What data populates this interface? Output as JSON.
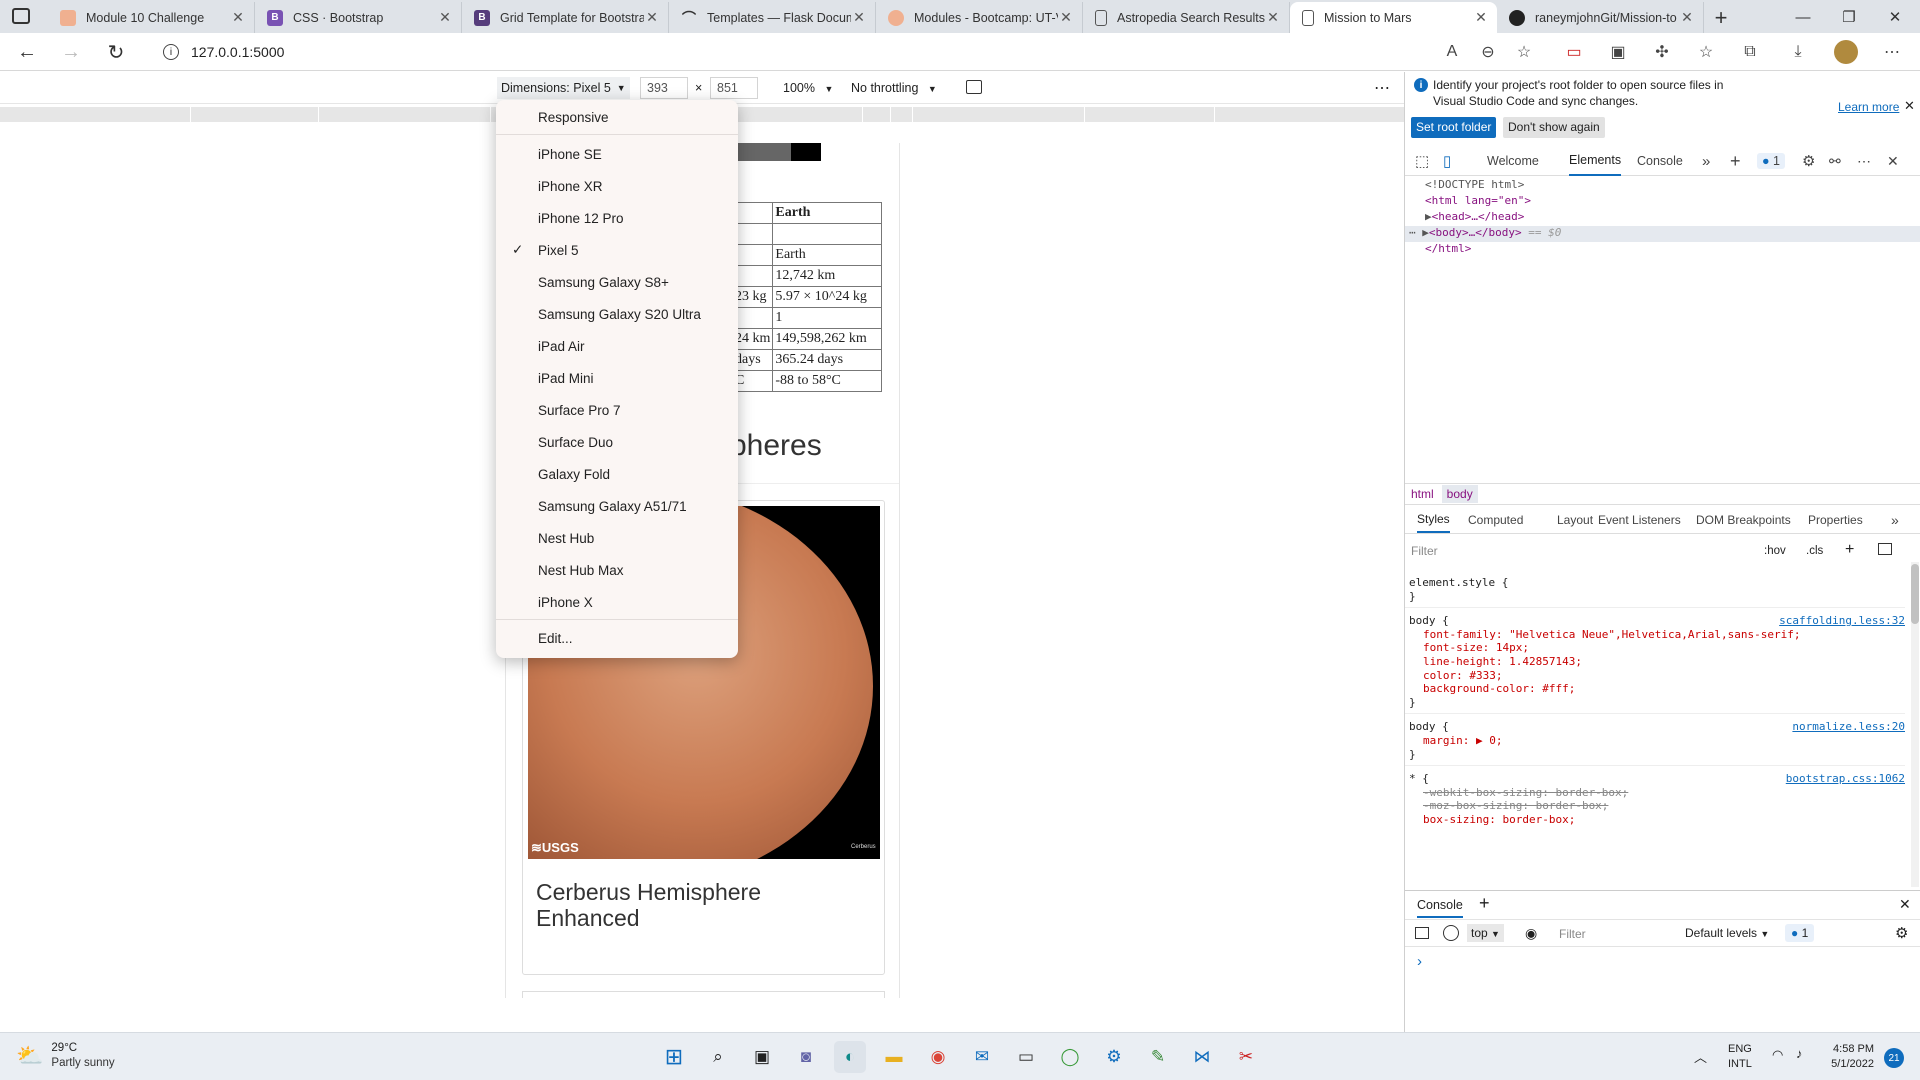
{
  "browser": {
    "tabs": [
      {
        "label": "Module 10 Challenge",
        "favicon": "orange-module-icon",
        "color": "#e8a07a"
      },
      {
        "label": "CSS · Bootstrap",
        "favicon": "bootstrap-icon",
        "color": "#7952b3"
      },
      {
        "label": "Grid Template for Bootstrap",
        "favicon": "bootstrap-icon",
        "color": "#563d7c"
      },
      {
        "label": "Templates — Flask Docum",
        "favicon": "flask-icon",
        "color": "#555555"
      },
      {
        "label": "Modules - Bootcamp: UT-V",
        "favicon": "canvas-icon",
        "color": "#e8a07a"
      },
      {
        "label": "Astropedia Search Results",
        "favicon": "page-icon",
        "color": "#888888"
      },
      {
        "label": "Mission to Mars",
        "favicon": "page-icon",
        "color": "#888888",
        "active": true
      },
      {
        "label": "raneymjohnGit/Mission-to",
        "favicon": "github-icon",
        "color": "#222222"
      }
    ],
    "new_tab": "+",
    "url": "127.0.0.1:5000"
  },
  "device_toolbar": {
    "dimensions_label": "Dimensions: Pixel 5",
    "width": "393",
    "times": "×",
    "height": "851",
    "zoom": "100%",
    "throttling": "No throttling",
    "more": "⋯"
  },
  "device_menu": {
    "responsive": "Responsive",
    "devices": [
      "iPhone SE",
      "iPhone XR",
      "iPhone 12 Pro",
      "Pixel 5",
      "Samsung Galaxy S8+",
      "Samsung Galaxy S20 Ultra",
      "iPad Air",
      "iPad Mini",
      "Surface Pro 7",
      "Surface Duo",
      "Galaxy Fold",
      "Samsung Galaxy A51/71",
      "Nest Hub",
      "Nest Hub Max",
      "iPhone X"
    ],
    "selected": "Pixel 5",
    "edit": "Edit..."
  },
  "page": {
    "table_header": "Earth",
    "table_rows": [
      [
        "",
        ""
      ],
      [
        "",
        "Earth"
      ],
      [
        "",
        "12,742 km"
      ],
      [
        "23 kg",
        "5.97 × 10^24 kg"
      ],
      [
        "",
        "1"
      ],
      [
        "24 km",
        "149,598,262 km"
      ],
      [
        "days",
        "365.24 days"
      ],
      [
        "C",
        "-88 to 58°C"
      ]
    ],
    "hemispheres_heading": "pheres",
    "card_title": "Cerberus Hemisphere Enhanced",
    "image_logo": "≋USGS",
    "image_caption": "Cerberus"
  },
  "devtools": {
    "notice": "Identify your project's root folder to open source files in Visual Studio Code and sync changes.",
    "learn_more": "Learn more",
    "set_root_folder": "Set root folder",
    "dont_show": "Don't show again",
    "tabs": [
      "Welcome",
      "Elements",
      "Console"
    ],
    "issue_count": "1",
    "dom": {
      "doctype": "<!DOCTYPE html>",
      "html_open": "<html lang=\"en\">",
      "head": "<head>…</head>",
      "body": "<body>…</body>",
      "body_suffix": "== $0",
      "html_close": "</html>"
    },
    "breadcrumbs": [
      "html",
      "body"
    ],
    "style_tabs": [
      "Styles",
      "Computed",
      "Layout",
      "Event Listeners",
      "DOM Breakpoints",
      "Properties"
    ],
    "filter_placeholder": "Filter",
    "hov": ":hov",
    "cls": ".cls",
    "rules": {
      "element_style": "element.style {",
      "close": "}",
      "body_selector": "body {",
      "source1": "scaffolding.less:32",
      "props1": [
        "font-family: \"Helvetica Neue\",Helvetica,Arial,sans-serif;",
        "font-size: 14px;",
        "line-height: 1.42857143;",
        "color: #333;",
        "background-color: #fff;"
      ],
      "source2": "normalize.less:20",
      "props2": [
        "margin: ▶ 0;"
      ],
      "universal": "* {",
      "source3": "bootstrap.css:1062",
      "props3": [
        "-webkit-box-sizing: border-box;",
        "-moz-box-sizing: border-box;",
        "box-sizing: border-box;"
      ]
    },
    "console": {
      "title": "Console",
      "context": "top",
      "filter_placeholder": "Filter",
      "levels": "Default levels",
      "count": "1",
      "prompt": "›"
    }
  },
  "taskbar": {
    "temperature": "29°C",
    "weather": "Partly sunny",
    "lang1": "ENG",
    "lang2": "INTL",
    "time": "4:58 PM",
    "date": "5/1/2022",
    "notifications": "21"
  },
  "colors": {
    "accent": "#0f6cbd",
    "tabbar": "#dfe3e8",
    "mars": "#c87a52"
  }
}
